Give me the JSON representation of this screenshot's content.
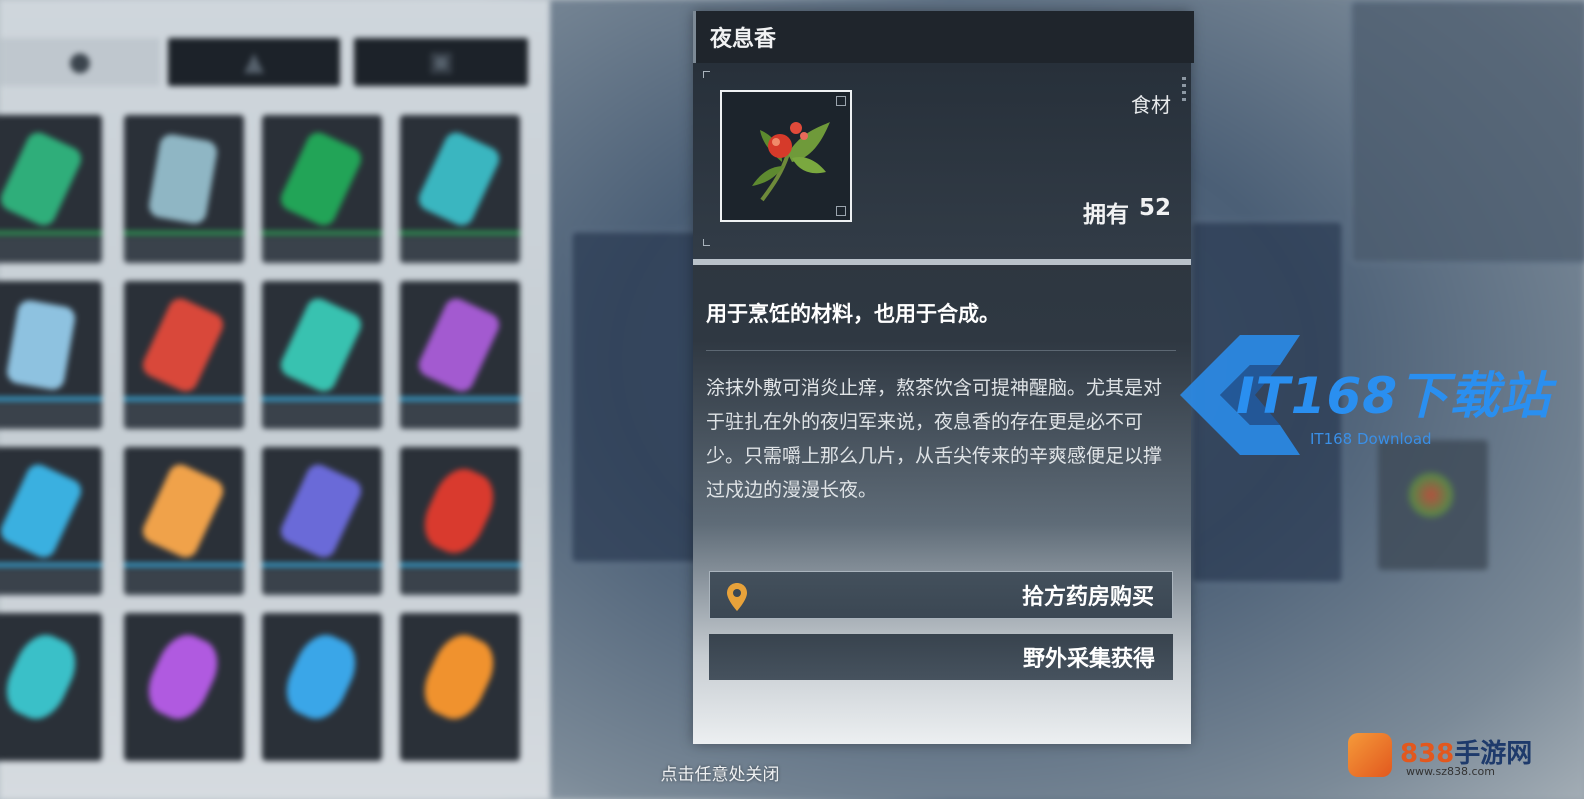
{
  "item": {
    "name": "夜息香",
    "category": "食材",
    "owned_label": "拥有",
    "owned_count": "52",
    "summary": "用于烹饪的材料，也用于合成。",
    "description": "涂抹外敷可消炎止痒，熬茶饮含可提神醒脑。尤其是对于驻扎在外的夜归军来说，夜息香的存在更是必不可少。只需嚼上那么几片，从舌尖传来的辛爽感便足以撑过戍边的漫漫长夜。",
    "icon": "red-berry-herb-icon"
  },
  "sources": [
    {
      "label": "拾方药房购买",
      "icon": "location-pin-icon",
      "pin_color": "#e8a23a"
    },
    {
      "label": "野外采集获得"
    }
  ],
  "close_hint": "点击任意处关闭",
  "watermarks": {
    "it168_text": "IT168下载站",
    "it168_sub": "IT168 Download",
    "site838_num": "838",
    "site838_text": "手游网",
    "site838_url": "www.sz838.com"
  },
  "colors": {
    "accent_blue": "#2a8ff0",
    "accent_orange": "#e2581e"
  }
}
